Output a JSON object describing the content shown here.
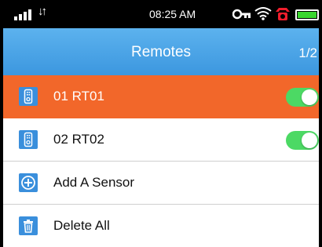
{
  "status_bar": {
    "time": "08:25 AM",
    "data_arrows": "↓↑",
    "icons": [
      "signal-icon",
      "data-transfer-icon",
      "key-icon",
      "wifi-icon",
      "alarm-icon",
      "battery-icon"
    ],
    "battery_color": "#39d62e"
  },
  "header": {
    "title": "Remotes",
    "page_indicator": "1/2",
    "background": "#4aa6e6"
  },
  "remotes": [
    {
      "label": "01 RT01",
      "icon": "remote-control-icon",
      "enabled": true,
      "selected": true
    },
    {
      "label": "02 RT02",
      "icon": "remote-control-icon",
      "enabled": true,
      "selected": false
    }
  ],
  "actions": [
    {
      "label": "Add A Sensor",
      "icon": "add-icon"
    },
    {
      "label": "Delete All",
      "icon": "trash-icon"
    }
  ],
  "colors": {
    "selected_row": "#f2672a",
    "toggle_on": "#4cd964",
    "icon_tile": "#3a8fdc"
  }
}
